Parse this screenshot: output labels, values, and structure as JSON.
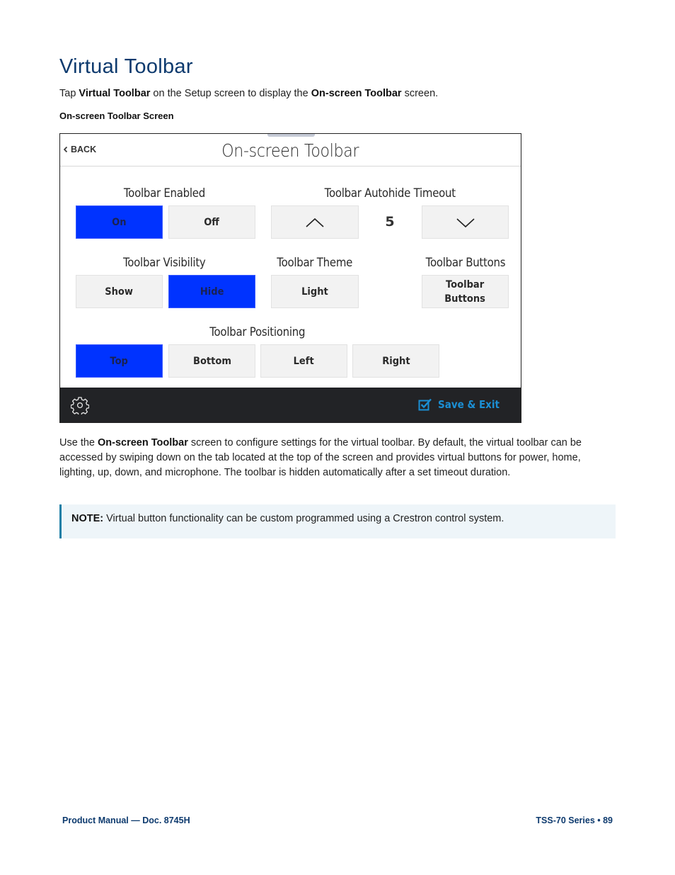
{
  "page": {
    "title": "Virtual Toolbar",
    "intro": {
      "prefix": "Tap ",
      "bold1": "Virtual Toolbar",
      "middle": " on the Setup screen to display the ",
      "bold2": "On-screen Toolbar",
      "suffix": " screen."
    },
    "caption": "On-screen Toolbar Screen"
  },
  "screen": {
    "back_label": "BACK",
    "title": "On-screen Toolbar",
    "toolbar_enabled": {
      "label": "Toolbar Enabled",
      "options": [
        "On",
        "Off"
      ],
      "selected": "On"
    },
    "autohide_timeout": {
      "label": "Toolbar Autohide Timeout",
      "value": "5",
      "up_icon": "chevron-up-icon",
      "down_icon": "chevron-down-icon"
    },
    "toolbar_visibility": {
      "label": "Toolbar Visibility",
      "options": [
        "Show",
        "Hide"
      ],
      "selected": "Hide"
    },
    "toolbar_theme": {
      "label": "Toolbar Theme",
      "value": "Light"
    },
    "toolbar_buttons": {
      "label": "Toolbar Buttons",
      "button_line1": "Toolbar",
      "button_line2": "Buttons"
    },
    "toolbar_positioning": {
      "label": "Toolbar Positioning",
      "options": [
        "Top",
        "Bottom",
        "Left",
        "Right"
      ],
      "selected": "Top"
    },
    "footer": {
      "settings_icon": "gear-icon",
      "save_label": "Save & Exit",
      "save_icon": "checkbox-checked-icon"
    },
    "colors": {
      "active": "#0033ff",
      "footer_bg": "#222326",
      "save_accent": "#1b8fd4"
    }
  },
  "body": {
    "prefix": "Use the ",
    "bold": "On-screen Toolbar",
    "text": " screen to configure settings for the virtual toolbar. By default, the virtual toolbar can be accessed by swiping down on the tab located at the top of the screen and provides virtual buttons for power, home, lighting, up, down, and microphone. The toolbar is hidden automatically after a set timeout duration."
  },
  "note": {
    "label": "NOTE:",
    "text": " Virtual button functionality can be custom programmed using a Crestron control system."
  },
  "footer": {
    "left": "Product Manual — Doc. 8745H",
    "right": "TSS-70 Series • 89"
  }
}
